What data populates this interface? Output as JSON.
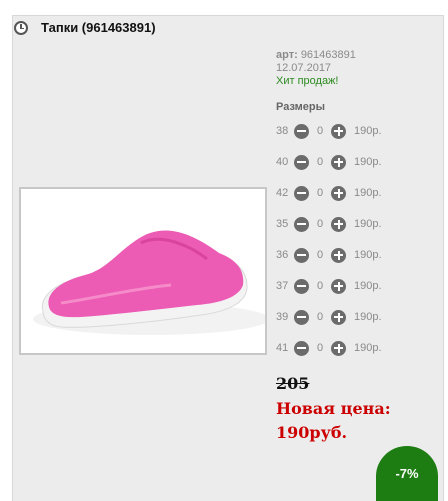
{
  "product": {
    "title": "Тапки (961463891)",
    "art_label": "арт:",
    "art_value": "961463891",
    "date": "12.07.2017",
    "badge": "Хит продаж!",
    "sizes_title": "Размеры",
    "sizes": [
      {
        "size": "38",
        "qty": "0",
        "price": "190р."
      },
      {
        "size": "40",
        "qty": "0",
        "price": "190р."
      },
      {
        "size": "42",
        "qty": "0",
        "price": "190р."
      },
      {
        "size": "35",
        "qty": "0",
        "price": "190р."
      },
      {
        "size": "36",
        "qty": "0",
        "price": "190р."
      },
      {
        "size": "37",
        "qty": "0",
        "price": "190р."
      },
      {
        "size": "39",
        "qty": "0",
        "price": "190р."
      },
      {
        "size": "41",
        "qty": "0",
        "price": "190р."
      }
    ],
    "old_price": "205",
    "new_price_label": "Новая цена:",
    "new_price_value": "190руб.",
    "discount": "-7%"
  },
  "colors": {
    "slipper_pink": "#ec5bb4",
    "discount_green": "#1d7d12",
    "new_price_red": "#cc0000",
    "hit_green": "#2b8a1f"
  }
}
